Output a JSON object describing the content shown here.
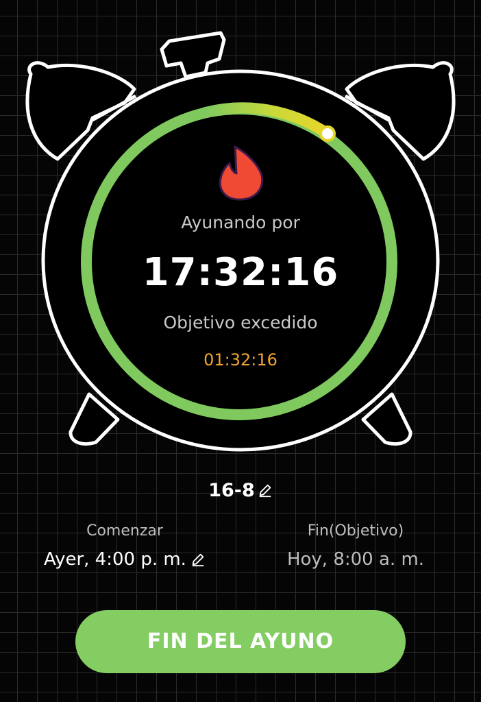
{
  "timer": {
    "fasting_label": "Ayunando por",
    "elapsed": "17:32:16",
    "exceeded_label": "Objetivo excedido",
    "exceeded_time": "01:32:16",
    "progress_fraction": 1.0
  },
  "plan": {
    "name": "16-8",
    "edit_icon": "pencil-icon"
  },
  "schedule": {
    "start_label": "Comenzar",
    "start_value": "Ayer, 4:00 p. m.",
    "end_label": "Fin(Objetivo)",
    "end_value": "Hoy, 8:00 a. m."
  },
  "actions": {
    "end_fast_label": "FIN DEL AYUNO"
  },
  "icons": {
    "status": "flame-icon",
    "clock": "alarm-clock-icon"
  },
  "colors": {
    "progress_green": "#7fc95f",
    "progress_yellow": "#e4d629",
    "exceeded_orange": "#f0a433",
    "flame_red": "#f04a35",
    "button_green": "#83cd62",
    "background": "#050505"
  }
}
